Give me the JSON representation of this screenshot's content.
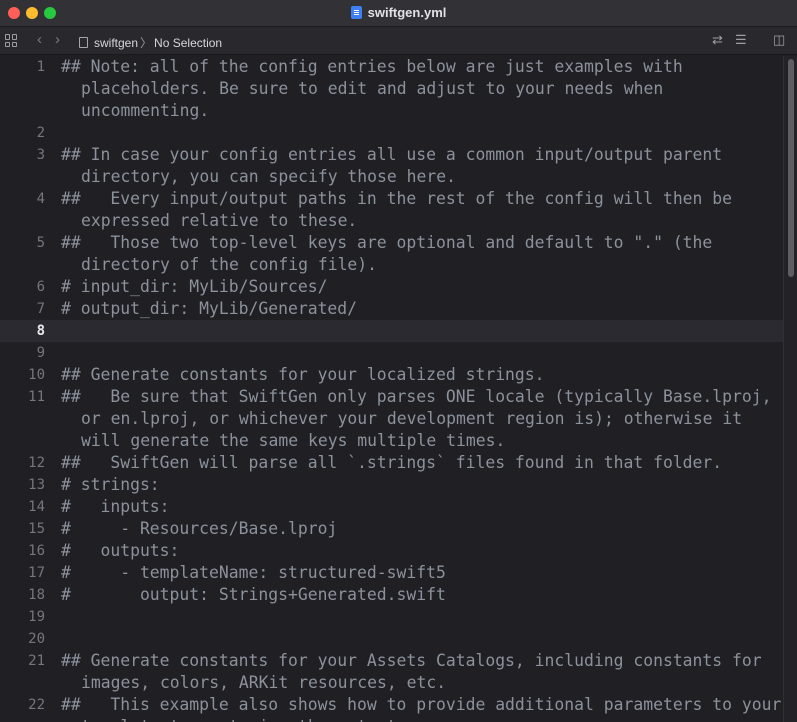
{
  "window": {
    "title": "swiftgen.yml"
  },
  "toolbar": {
    "breadcrumb_project": "swiftgen",
    "breadcrumb_selection": "No Selection"
  },
  "editor": {
    "current_line": 8,
    "lines": [
      {
        "num": "1",
        "text": "## Note: all of the config entries below are just examples with placeholders. Be sure to edit and adjust to your needs when uncommenting."
      },
      {
        "num": "2",
        "text": ""
      },
      {
        "num": "3",
        "text": "## In case your config entries all use a common input/output parent directory, you can specify those here."
      },
      {
        "num": "4",
        "text": "##   Every input/output paths in the rest of the config will then be expressed relative to these."
      },
      {
        "num": "5",
        "text": "##   Those two top-level keys are optional and default to \".\" (the directory of the config file)."
      },
      {
        "num": "6",
        "text": "# input_dir: MyLib/Sources/"
      },
      {
        "num": "7",
        "text": "# output_dir: MyLib/Generated/"
      },
      {
        "num": "8",
        "text": ""
      },
      {
        "num": "9",
        "text": ""
      },
      {
        "num": "10",
        "text": "## Generate constants for your localized strings."
      },
      {
        "num": "11",
        "text": "##   Be sure that SwiftGen only parses ONE locale (typically Base.lproj, or en.lproj, or whichever your development region is); otherwise it will generate the same keys multiple times."
      },
      {
        "num": "12",
        "text": "##   SwiftGen will parse all `.strings` files found in that folder."
      },
      {
        "num": "13",
        "text": "# strings:"
      },
      {
        "num": "14",
        "text": "#   inputs:"
      },
      {
        "num": "15",
        "text": "#     - Resources/Base.lproj"
      },
      {
        "num": "16",
        "text": "#   outputs:"
      },
      {
        "num": "17",
        "text": "#     - templateName: structured-swift5"
      },
      {
        "num": "18",
        "text": "#       output: Strings+Generated.swift"
      },
      {
        "num": "19",
        "text": ""
      },
      {
        "num": "20",
        "text": ""
      },
      {
        "num": "21",
        "text": "## Generate constants for your Assets Catalogs, including constants for images, colors, ARKit resources, etc."
      },
      {
        "num": "22",
        "text": "##   This example also shows how to provide additional parameters to your template to customize the output."
      }
    ]
  }
}
